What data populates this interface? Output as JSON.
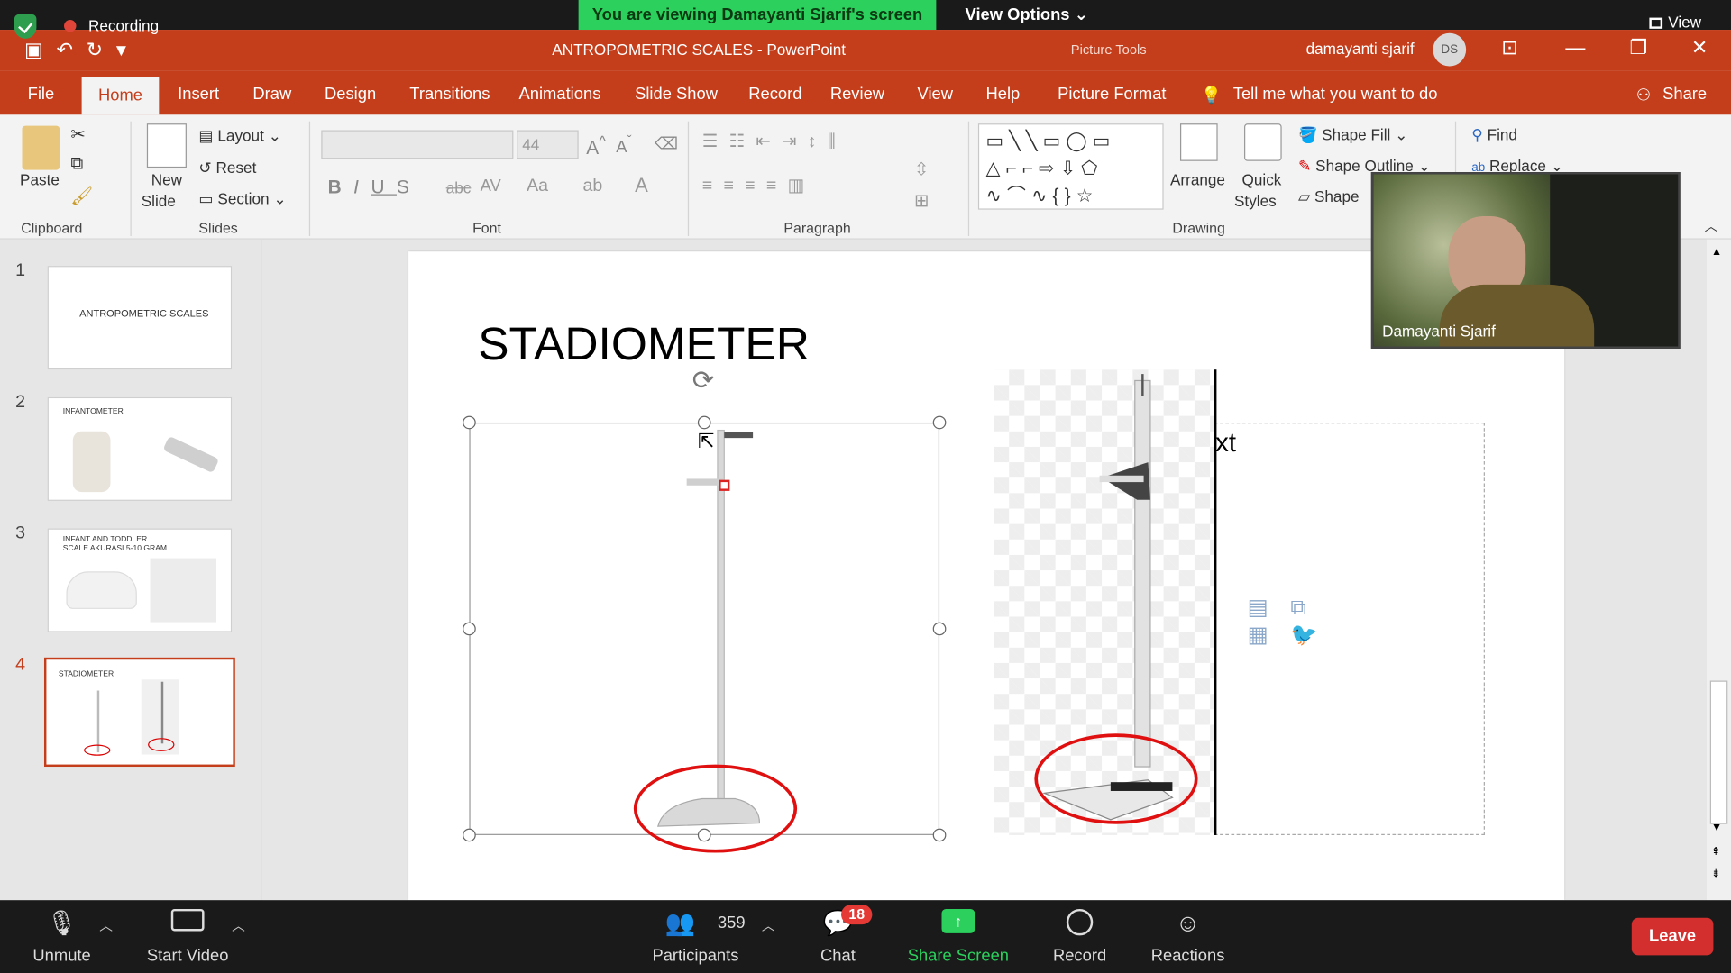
{
  "zoom_top": {
    "recording": "Recording",
    "viewing_banner": "You are viewing Damayanti Sjarif's screen",
    "view_options": "View Options ⌄",
    "view": "View"
  },
  "titlebar": {
    "doc_title": "ANTROPOMETRIC SCALES  -  PowerPoint",
    "picture_tools": "Picture Tools",
    "user": "damayanti sjarif",
    "user_initials": "DS"
  },
  "ribbon_tabs": [
    "File",
    "Home",
    "Insert",
    "Draw",
    "Design",
    "Transitions",
    "Animations",
    "Slide Show",
    "Record",
    "Review",
    "View",
    "Help",
    "Picture Format"
  ],
  "tell_me": "Tell me what you want to do",
  "share": "Share",
  "ribbon": {
    "paste": "Paste",
    "clipboard": "Clipboard",
    "new_slide_1": "New",
    "new_slide_2": "Slide",
    "layout": "Layout",
    "reset": "Reset",
    "section": "Section",
    "slides": "Slides",
    "font_size": "44",
    "font": "Font",
    "paragraph": "Paragraph",
    "arrange": "Arrange",
    "quick_styles_1": "Quick",
    "quick_styles_2": "Styles",
    "shape_fill": "Shape Fill",
    "shape_outline": "Shape Outline",
    "shape_effects": "Shape",
    "drawing": "Drawing",
    "find": "Find",
    "replace": "Replace"
  },
  "thumbnails": [
    {
      "num": "1",
      "text": "ANTROPOMETRIC SCALES"
    },
    {
      "num": "2",
      "text": "INFANTOMETER"
    },
    {
      "num": "3",
      "text": "INFANT AND TODDLER SCALE AKURASI 5-10 GRAM"
    },
    {
      "num": "4",
      "text": "STADIOMETER"
    }
  ],
  "slide": {
    "title": "STADIOMETER",
    "placeholder_text": "xt"
  },
  "video": {
    "name": "Damayanti Sjarif"
  },
  "zoom_bottom": {
    "unmute": "Unmute",
    "start_video": "Start Video",
    "participants_count": "359",
    "participants": "Participants",
    "chat_badge": "18",
    "chat": "Chat",
    "share_screen": "Share Screen",
    "record": "Record",
    "reactions": "Reactions",
    "leave": "Leave"
  },
  "colors": {
    "ppt_accent": "#c43e1c",
    "zoom_green": "#2bd15c",
    "leave_red": "#d32f2f"
  }
}
